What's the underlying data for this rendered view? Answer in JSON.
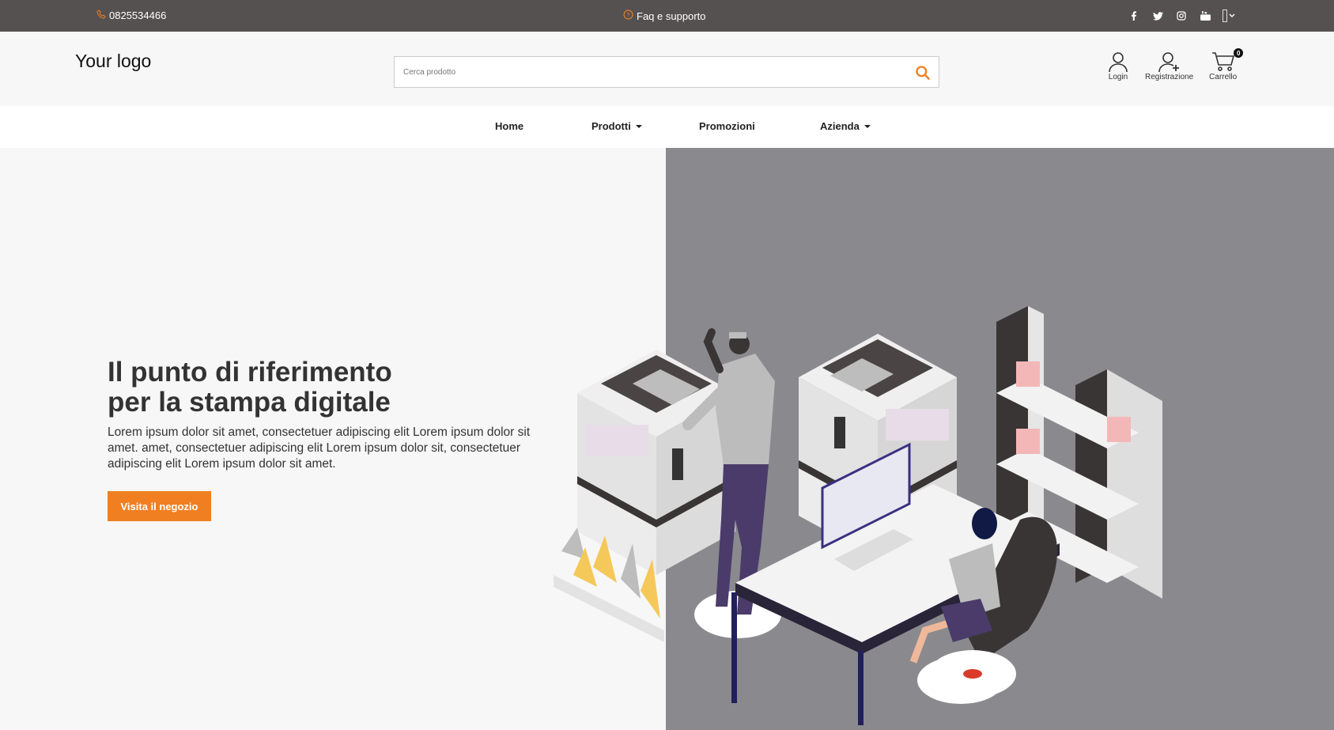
{
  "topbar": {
    "phone": "0825534466",
    "faq": "Faq e supporto",
    "social_icons": [
      "facebook-icon",
      "twitter-icon",
      "instagram-icon",
      "youtube-icon"
    ],
    "language": "it-flag"
  },
  "header": {
    "logo": "Your logo",
    "search_placeholder": "Cerca prodotto",
    "login_label": "Login",
    "register_label": "Registrazione",
    "cart_label": "Carrello",
    "cart_count": "0"
  },
  "nav": {
    "items": [
      {
        "label": "Home"
      },
      {
        "label": "Prodotti"
      },
      {
        "label": "Promozioni"
      },
      {
        "label": "Azienda"
      }
    ]
  },
  "hero": {
    "title_line1": "Il punto di riferimento",
    "title_line2": "per la stampa digitale",
    "text": "Lorem ipsum dolor sit amet, consectetuer adipiscing elit Lorem ipsum dolor sit amet. amet, consectetuer adipiscing elit Lorem ipsum dolor sit, consectetuer adipiscing elit Lorem ipsum dolor sit amet.",
    "cta_label": "Visita il negozio"
  },
  "colors": {
    "topbar_bg": "#565151",
    "accent": "#f07f22",
    "panel_gray": "#8a8a8e"
  }
}
